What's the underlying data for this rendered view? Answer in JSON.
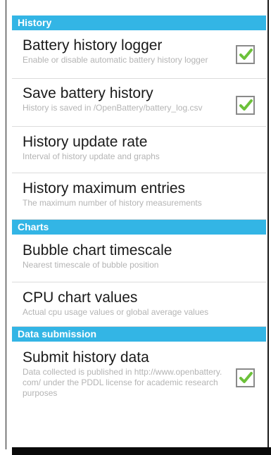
{
  "sections": [
    {
      "header": "History",
      "items": [
        {
          "title": "Battery history logger",
          "summary": "Enable or disable automatic battery history logger",
          "checked": true
        },
        {
          "title": "Save battery history",
          "summary": "History is saved in /OpenBattery/battery_log.csv",
          "checked": true
        },
        {
          "title": "History update rate",
          "summary": "Interval of history update and graphs"
        },
        {
          "title": "History maximum entries",
          "summary": "The maximum number of history measurements"
        }
      ]
    },
    {
      "header": "Charts",
      "items": [
        {
          "title": "Bubble chart timescale",
          "summary": "Nearest timescale of bubble position"
        },
        {
          "title": "CPU chart values",
          "summary": "Actual cpu usage values or global average values"
        }
      ]
    },
    {
      "header": "Data submission",
      "items": [
        {
          "title": "Submit history data",
          "summary": "Data collected is published in http://www.openbattery.com/ under the PDDL license for academic research purposes",
          "checked": true
        }
      ]
    }
  ],
  "colors": {
    "section_header_bg": "#33b5e5",
    "check_green": "#6cc13a",
    "summary_gray": "#b4b4b4"
  },
  "icons": {
    "checkbox_checked": "checkmark-icon"
  }
}
